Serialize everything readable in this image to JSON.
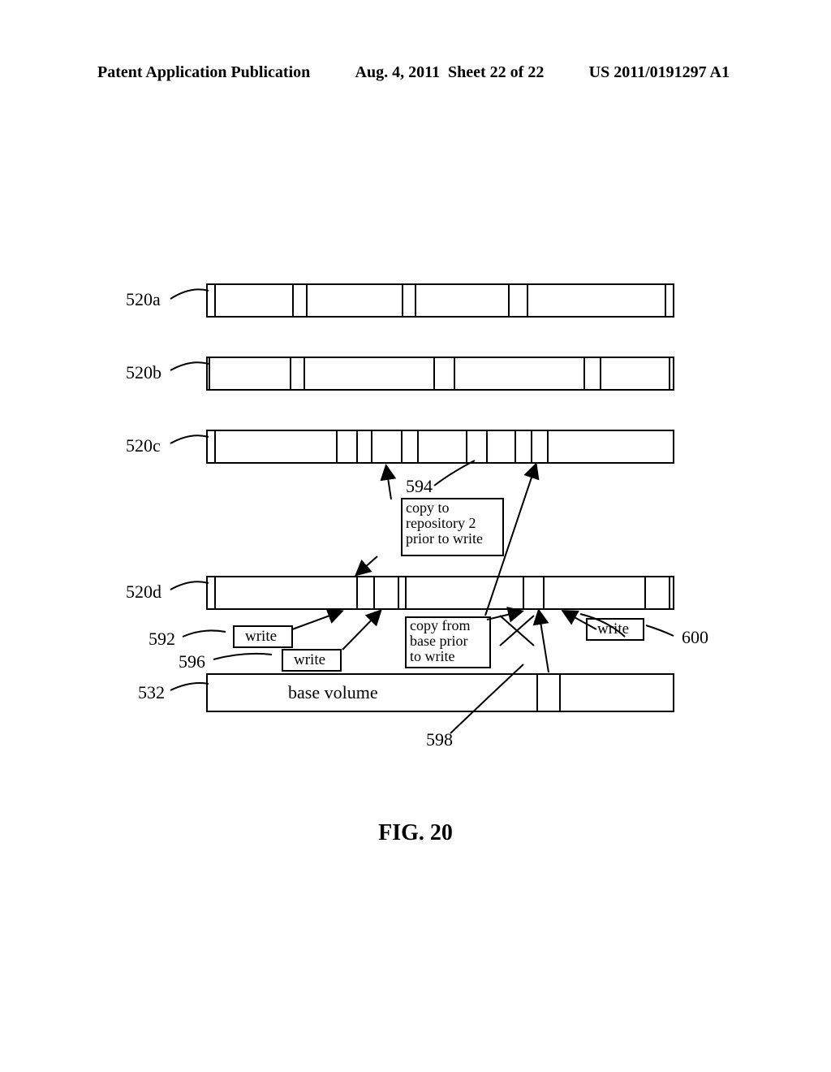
{
  "header": {
    "left": "Patent Application Publication",
    "center": "Aug. 4, 2011  Sheet 22 of 22",
    "right": "US 2011/0191297 A1"
  },
  "refs": {
    "r520a": "520a",
    "r520b": "520b",
    "r520c": "520c",
    "r520d": "520d",
    "r592": "592",
    "r596": "596",
    "r532": "532",
    "r594": "594",
    "r598": "598",
    "r600": "600"
  },
  "boxes": {
    "write1": "write",
    "write2": "write",
    "write3": "write",
    "copy_to_repo2": "copy to\nrepository 2\nprior to write",
    "copy_from_base": "copy from\nbase prior\nto write",
    "base_volume": "base volume"
  },
  "figure": "FIG. 20"
}
